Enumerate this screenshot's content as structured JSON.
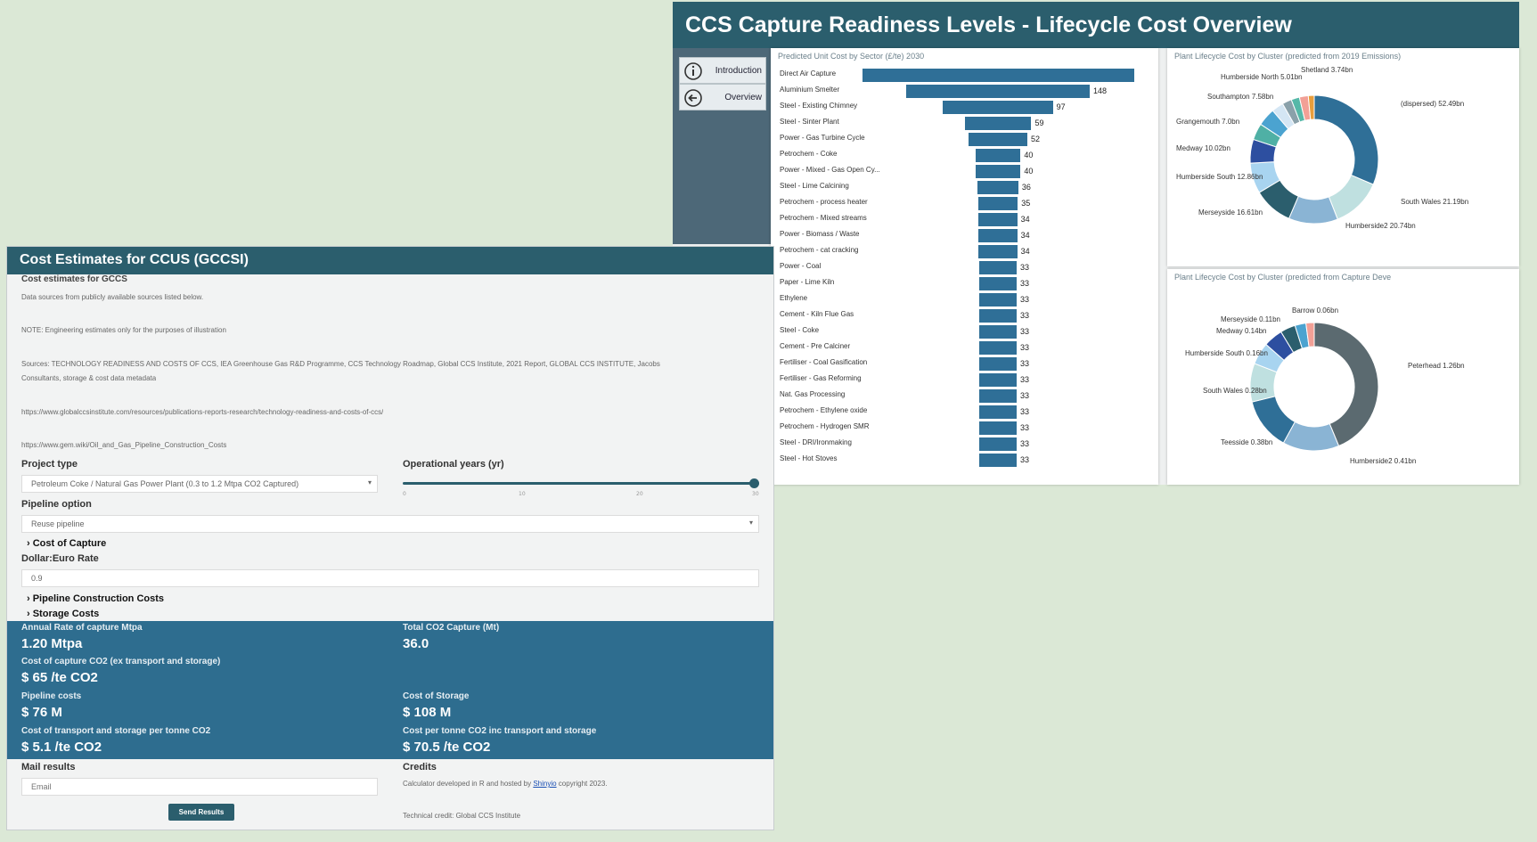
{
  "dashboard": {
    "title": "CCS Capture Readiness Levels - Lifecycle Cost Overview",
    "nav": [
      {
        "label": "Introduction",
        "icon": "info-icon"
      },
      {
        "label": "Overview",
        "icon": "back-arrow-icon"
      }
    ],
    "bar_panel_title": "Predicted Unit Cost by Sector (£/te) 2030",
    "pie1_title": "Plant Lifecycle Cost by Cluster (predicted from 2019 Emissions)",
    "pie2_title": "Plant Lifecycle Cost by Cluster (predicted from Capture Deve"
  },
  "chart_data": [
    {
      "type": "bar",
      "orientation": "horizontal",
      "title": "Predicted Unit Cost by Sector (£/te) 2030",
      "categories": [
        "Direct Air Capture",
        "Aluminium Smelter",
        "Steel - Existing Chimney",
        "Steel - Sinter Plant",
        "Power - Gas Turbine Cycle",
        "Petrochem - Coke",
        "Power - Mixed - Gas Open Cy...",
        "Steel - Lime Calcining",
        "Petrochem - process heater",
        "Petrochem - Mixed streams",
        "Power - Biomass / Waste",
        "Petrochem - cat cracking",
        "Power - Coal",
        "Paper - Lime Kiln",
        "Ethylene",
        "Cement - Kiln Flue Gas",
        "Steel - Coke",
        "Cement - Pre Calciner",
        "Fertiliser - Coal Gasification",
        "Fertiliser - Gas Reforming",
        "Nat. Gas Processing",
        "Petrochem - Ethylene oxide",
        "Petrochem - Hydrogen SMR",
        "Steel - DRI/Ironmaking",
        "Steel - Hot Stoves"
      ],
      "values": [
        240,
        162,
        97,
        59,
        52,
        40,
        40,
        36,
        35,
        34,
        34,
        34,
        33,
        33,
        33,
        33,
        33,
        33,
        33,
        33,
        33,
        33,
        33,
        33,
        33
      ],
      "value_labels": [
        "",
        "148",
        "97",
        "59",
        "52",
        "40",
        "40",
        "36",
        "35",
        "34",
        "34",
        "34",
        "33",
        "33",
        "33",
        "33",
        "33",
        "33",
        "33",
        "33",
        "33",
        "33",
        "33",
        "33",
        "33"
      ]
    },
    {
      "type": "pie",
      "variant": "donut",
      "title": "Plant Lifecycle Cost by Cluster (predicted from 2019 Emissions)",
      "slices": [
        {
          "label": "(dispersed) 52.49bn",
          "value": 52.49,
          "color": "#2f6f97"
        },
        {
          "label": "South Wales 21.19bn",
          "value": 21.19,
          "color": "#bfe0e0"
        },
        {
          "label": "Humberside2 20.74bn",
          "value": 20.74,
          "color": "#8ab4d4"
        },
        {
          "label": "Merseyside 16.61bn",
          "value": 16.61,
          "color": "#2b5e6d"
        },
        {
          "label": "Humberside South 12.86bn",
          "value": 12.86,
          "color": "#a8d4f0"
        },
        {
          "label": "Medway 10.02bn",
          "value": 10.02,
          "color": "#2d4fa0"
        },
        {
          "label": "Grangemouth 7.0bn",
          "value": 7.0,
          "color": "#4fb0a5"
        },
        {
          "label": "Southampton 7.58bn",
          "value": 7.58,
          "color": "#4ba3d0"
        },
        {
          "label": "Humberside North 5.01bn",
          "value": 5.01,
          "color": "#d4e6f4"
        },
        {
          "label": "",
          "value": 4.0,
          "color": "#8aa1aa"
        },
        {
          "label": "",
          "value": 3.5,
          "color": "#56b8a8"
        },
        {
          "label": "Shetland 3.74bn",
          "value": 3.74,
          "color": "#f2a096"
        },
        {
          "label": "",
          "value": 2.5,
          "color": "#e89e3c"
        }
      ]
    },
    {
      "type": "pie",
      "variant": "donut",
      "title": "Plant Lifecycle Cost by Cluster (predicted from Capture Deve",
      "slices": [
        {
          "label": "Peterhead 1.26bn",
          "value": 1.26,
          "color": "#5b6a70"
        },
        {
          "label": "Humberside2 0.41bn",
          "value": 0.41,
          "color": "#8ab4d4"
        },
        {
          "label": "Teesside 0.38bn",
          "value": 0.38,
          "color": "#2f6f97"
        },
        {
          "label": "South Wales 0.28bn",
          "value": 0.28,
          "color": "#bfe0e0"
        },
        {
          "label": "Humberside South 0.16bn",
          "value": 0.16,
          "color": "#a8d4f0"
        },
        {
          "label": "Medway 0.14bn",
          "value": 0.14,
          "color": "#2d4fa0"
        },
        {
          "label": "Merseyside 0.11bn",
          "value": 0.11,
          "color": "#2b5e6d"
        },
        {
          "label": "",
          "value": 0.08,
          "color": "#4ba3d0"
        },
        {
          "label": "Barrow 0.06bn",
          "value": 0.06,
          "color": "#f2a096"
        }
      ]
    }
  ],
  "calc": {
    "title": "Cost Estimates for CCUS (GCCSI)",
    "subtitle": "Cost estimates for GCCS",
    "para1": "Data sources from publicly available sources listed below.",
    "para2": "NOTE: Engineering estimates only for the purposes of illustration",
    "para3a": "Sources: TECHNOLOGY READINESS AND COSTS OF CCS, IEA Greenhouse Gas R&D Programme, CCS Technology Roadmap, Global CCS Institute, 2021 Report, GLOBAL CCS INSTITUTE, Jacobs",
    "para3b": "Consultants, storage & cost data metadata",
    "link1": "https://www.globalccsinstitute.com/resources/publications-reports-research/technology-readiness-and-costs-of-ccs/",
    "link2": "https://www.gem.wiki/Oil_and_Gas_Pipeline_Construction_Costs",
    "project_type_label": "Project type",
    "project_type_value": "Petroleum Coke / Natural Gas Power Plant (0.3 to 1.2 Mtpa CO2 Captured)",
    "op_years_label": "Operational years (yr)",
    "slider_ticks": [
      "0",
      "10",
      "20",
      "30"
    ],
    "slider_value_fraction": 1.0,
    "pipeline_label": "Pipeline option",
    "pipeline_value": "Reuse pipeline",
    "cost_capture": "› Cost of Capture",
    "dollar_label": "Dollar:Euro Rate",
    "dollar_value": "0.9",
    "pipeline_construction": "› Pipeline Construction Costs",
    "storage_costs": "› Storage Costs",
    "results": {
      "annual_label": "Annual Rate of capture Mtpa",
      "annual_value": "1.20 Mtpa",
      "total_label": "Total CO2 Capture (Mt)",
      "total_value": "36.0",
      "capture_cost_label": "Cost of capture CO2 (ex transport and storage)",
      "capture_cost_value": "$ 65 /te CO2",
      "pipeline_label": "Pipeline costs",
      "pipeline_value": "$ 76 M",
      "storage_label": "Cost of Storage",
      "storage_value": "$ 108 M",
      "ts_label": "Cost of transport and storage per tonne CO2",
      "ts_value": "$ 5.1 /te CO2",
      "total_cost_label": "Cost per tonne CO2 inc transport and storage",
      "total_cost_value": "$ 70.5 /te CO2"
    },
    "mail_label": "Mail results",
    "email_placeholder": "Email",
    "send_button": "Send Results",
    "credits_label": "Credits",
    "credits_prefix": "Calculator developed in R and hosted by ",
    "credits_link": "Shinyio",
    "credits_suffix": " copyright 2023.",
    "credits_line2": "Technical credit: Global CCS Institute"
  }
}
